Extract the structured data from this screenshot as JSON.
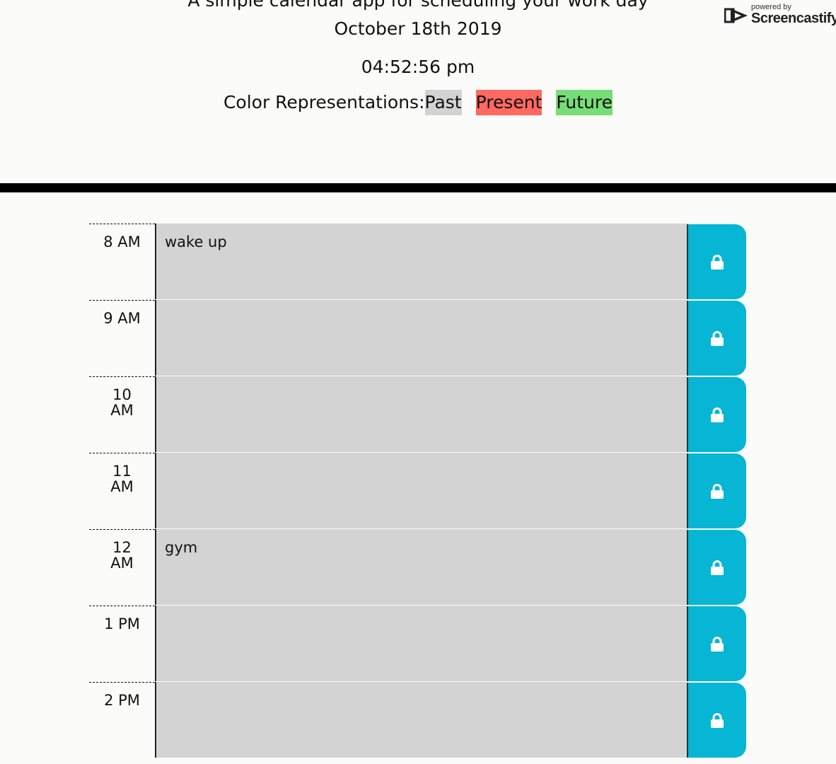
{
  "header": {
    "subtitle": "A simple calendar app for scheduling your work day",
    "date": "October 18th 2019",
    "time": "04:52:56 pm",
    "legend_label": "Color Representations:",
    "legend": [
      {
        "label": "Past",
        "color": "#d3d3d3"
      },
      {
        "label": "Present",
        "color": "#ff6961"
      },
      {
        "label": "Future",
        "color": "#77dd77"
      }
    ]
  },
  "watermark": {
    "small": "powered by",
    "big": "Screencastify"
  },
  "rows": [
    {
      "hour": "8 AM",
      "text": "wake up",
      "icon": "lock-icon"
    },
    {
      "hour": "9 AM",
      "text": "",
      "icon": "lock-icon"
    },
    {
      "hour": "10 AM",
      "text": "",
      "icon": "lock-icon"
    },
    {
      "hour": "11 AM",
      "text": "",
      "icon": "lock-icon"
    },
    {
      "hour": "12 AM",
      "text": "gym",
      "icon": "lock-icon"
    },
    {
      "hour": "1 PM",
      "text": "",
      "icon": "lock-icon"
    },
    {
      "hour": "2 PM",
      "text": "",
      "icon": "lock-icon"
    }
  ],
  "colors": {
    "save_button": "#06b6d4",
    "divider": "#000000",
    "background": "#fbfbf9"
  }
}
